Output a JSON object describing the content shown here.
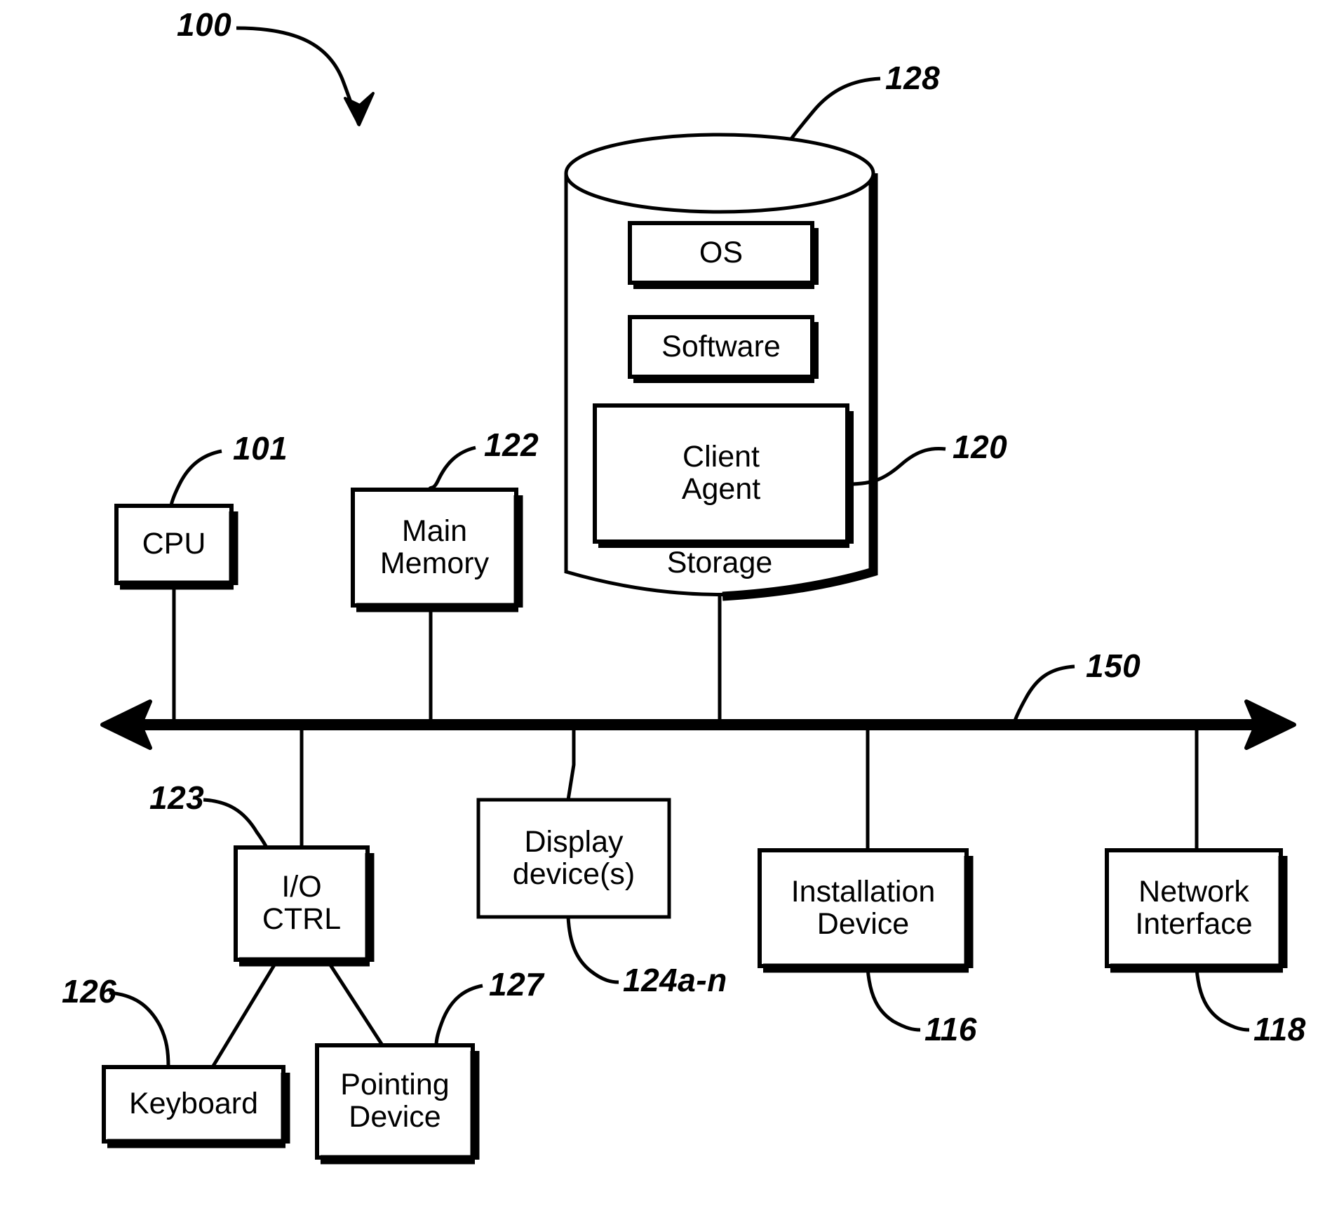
{
  "figure": {
    "root_numeral": "100",
    "bus_numeral": "150"
  },
  "storage": {
    "cylinder_label": "Storage",
    "cylinder_numeral": "128",
    "client_agent_numeral": "120",
    "contents": [
      {
        "label": "OS"
      },
      {
        "label": "Software"
      },
      {
        "label": "Client\nAgent"
      }
    ]
  },
  "top_row": [
    {
      "label": "CPU",
      "numeral": "101"
    },
    {
      "label": "Main\nMemory",
      "numeral": "122"
    }
  ],
  "bottom_row": [
    {
      "label": "I/O\nCTRL",
      "numeral": "123"
    },
    {
      "label": "Display\ndevice(s)",
      "numeral": "124a-n"
    },
    {
      "label": "Installation\nDevice",
      "numeral": "116"
    },
    {
      "label": "Network\nInterface",
      "numeral": "118"
    }
  ],
  "io_children": [
    {
      "label": "Keyboard",
      "numeral": "126"
    },
    {
      "label": "Pointing\nDevice",
      "numeral": "127"
    }
  ],
  "colors": {
    "ink": "#000000",
    "paper": "#ffffff"
  }
}
